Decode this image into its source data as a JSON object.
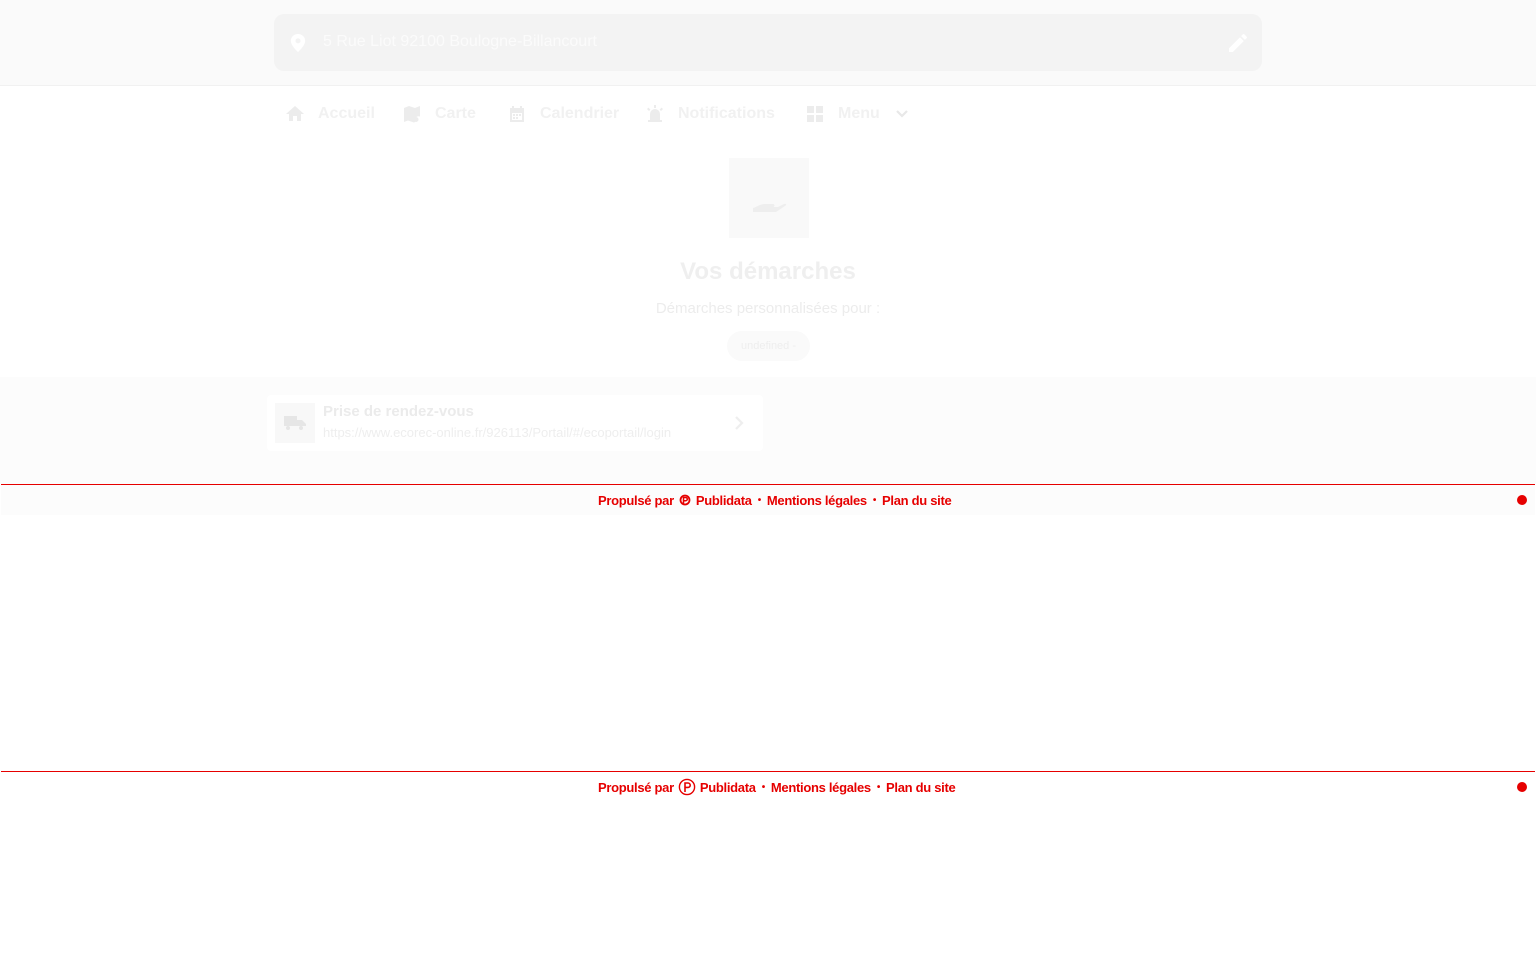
{
  "address": {
    "text": "5 Rue Liot 92100 Boulogne-Billancourt",
    "pin_icon": "location-pin-icon",
    "edit_icon": "pencil-icon"
  },
  "nav": {
    "items": [
      {
        "label": "Accueil",
        "icon": "home-icon"
      },
      {
        "label": "Carte",
        "icon": "map-icon"
      },
      {
        "label": "Calendrier",
        "icon": "calendar-icon"
      },
      {
        "label": "Notifications",
        "icon": "alarm-bell-icon"
      },
      {
        "label": "Menu",
        "icon": "grid-icon"
      }
    ]
  },
  "hero": {
    "icon": "helping-hand-icon",
    "title": "Vos démarches",
    "subtitle": "Démarches personnalisées pour :",
    "pill": "undefined -"
  },
  "card": {
    "icon": "truck-icon",
    "title": "Prise de rendez-vous",
    "url": "https://www.ecorec-online.fr/926113/Portail/#/ecoportail/login"
  },
  "footer": {
    "powered": "Propulsé par",
    "brand": "Publidata",
    "legal": "Mentions légales",
    "sitemap": "Plan du site",
    "separator": "•",
    "color": "#e60000"
  }
}
